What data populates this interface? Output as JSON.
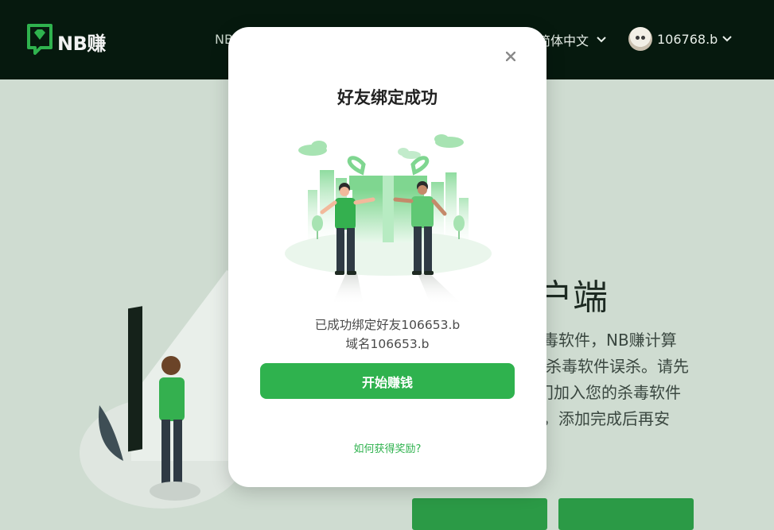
{
  "header": {
    "brand": "NB赚",
    "nav_item_partial": "NB",
    "language": "简体中文",
    "username": "106768.b"
  },
  "background_page": {
    "heading_partial": "户端",
    "paragraph_lines": [
      "毒软件，NB赚计算",
      "杀毒软件误杀。请先",
      "门加入您的杀毒软件",
      "，添加完成后再安"
    ]
  },
  "modal": {
    "title": "好友绑定成功",
    "message_line1": "已成功绑定好友106653.b",
    "message_line2": "域名106653.b",
    "primary_button": "开始赚钱",
    "help_link": "如何获得奖励?"
  },
  "colors": {
    "header_bg": "#06190e",
    "page_bg": "#cfdcd1",
    "accent_green": "#2fb24e"
  },
  "icons": {
    "close": "close-icon",
    "brand": "gem-logo-icon",
    "dropdown": "chevron-down-icon"
  }
}
